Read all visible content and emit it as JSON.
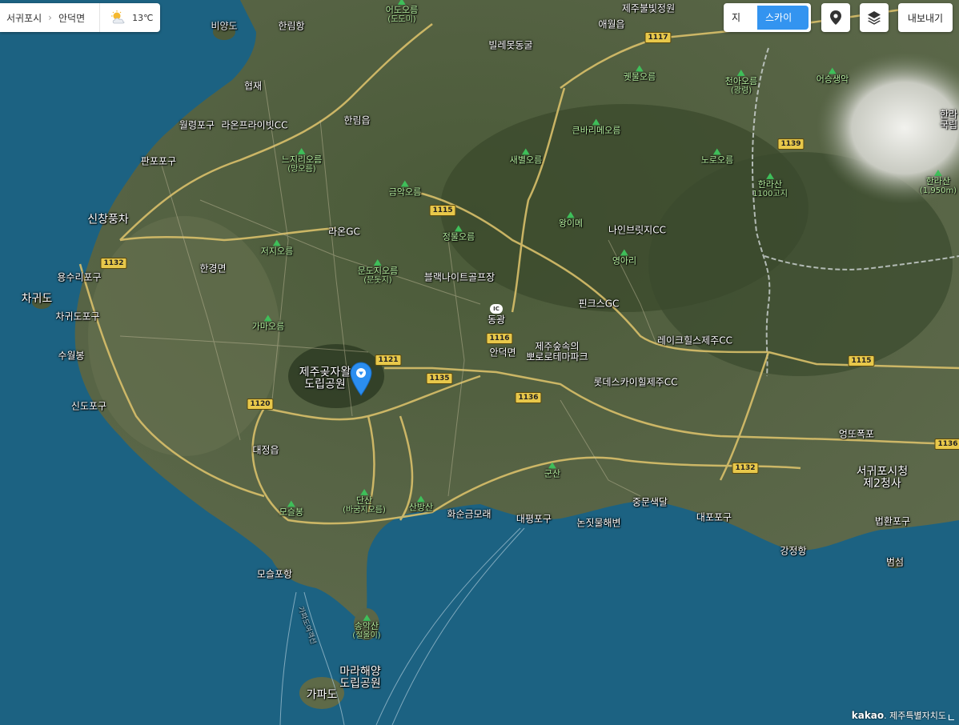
{
  "breadcrumb": {
    "region": "서귀포시",
    "subregion": "안덕면",
    "weather": {
      "icon": "partly-cloudy-icon",
      "temperature": "13℃"
    }
  },
  "controls": {
    "map_label": "지도",
    "skyview_label": "스카이뷰",
    "export_label": "내보내기",
    "location_icon": "location-pin-icon",
    "layers_icon": "layers-icon",
    "accent_color": "#3394f0"
  },
  "map": {
    "labels": {
      "biyangdo": "비양도",
      "hallim_port": "한림항",
      "hyeopjae": "협재",
      "woryeong_port": "월령포구",
      "laon_private": "라온프라이빗CC",
      "hallim_eup": "한림읍",
      "panpo_port": "판포포구",
      "sinchang_wind": "신창풍차",
      "yongsuri_port": "용수리포구",
      "chagwido": "차귀도",
      "chagwido_port": "차귀도포구",
      "suwolbong": "수월봉",
      "sindo_port": "신도포구",
      "hangyeong": "한경면",
      "eodo_oreum": "어도오름",
      "eodo_sub": "(도도미)",
      "jeju_bulbit": "제주불빛정원",
      "aewol": "애월읍",
      "billemot": "빌레못동굴",
      "kettle_oreum": "궷물오름",
      "cheona_oreum": "천아오름",
      "cheona_sub": "(광령)",
      "eoseungsaeng": "어승생악",
      "halla_village": "한라",
      "halla_village2": "국립",
      "keunbari": "큰바리메오름",
      "saebyeol": "새별오름",
      "noro": "노로오름",
      "hallasan_1100": "한라산",
      "hallasan_1100_sub": "1100고지",
      "hallasan_peak": "한라산",
      "hallasan_peak_sub": "(1,950m)",
      "neujigeori": "느지리오름",
      "neujigeori_sub": "(망오름)",
      "geumak": "금악오름",
      "jeongmul": "정물오름",
      "laon_gc": "라온GC",
      "wangi": "왕이메",
      "nine_bridge": "나인브릿지CC",
      "yeongari": "영아리",
      "jeoji": "저지오름",
      "mundoji": "문도지오름",
      "mundoji_sub": "(문돗지)",
      "black_night": "블랙나이트골프장",
      "donggwang": "동광",
      "pinx": "핀크스GC",
      "gamaoreum": "가마오름",
      "jeju_forest": "제주숲속의",
      "jeju_forest2": "뽀로로테마파크",
      "andeok": "안덕면",
      "lakehills": "레이크힐스제주CC",
      "gotjawal": "제주곶자왈",
      "gotjawal2": "도립공원",
      "lotte_sky": "롯데스카이힐제주CC",
      "daejeong": "대정읍",
      "eongtto": "엉또폭포",
      "seogwipo_hall": "서귀포시청",
      "seogwipo_hall2": "제2청사",
      "moseulbong": "모슬봉",
      "dansan": "단산",
      "dansan_sub": "(바굼지오름)",
      "sanbangsan": "산방산",
      "hwasun": "화순금모래",
      "gunsan": "군산",
      "daepyeong": "대평포구",
      "nonjit": "논짓물해변",
      "jungmun": "중문색달",
      "daepo": "대포포구",
      "beophwan": "법환포구",
      "gangjeong": "강정항",
      "beomseom": "범섬",
      "moseulpo": "모슬포항",
      "songaksan": "송악산",
      "songaksan_sub": "(절울이)",
      "mara1": "마라해양",
      "mara2": "도립공원",
      "gapado": "가파도",
      "ferry": "가파도여객선"
    },
    "road_shields": [
      "1117",
      "1139",
      "1115",
      "1132",
      "1116",
      "1121",
      "1135",
      "1136",
      "1120",
      "1115",
      "1132",
      "1136"
    ],
    "ic_label": "IC",
    "pin_color": "#2b8ef0"
  },
  "footer": {
    "brand": "kakao",
    "province": "제주특별자치도"
  }
}
